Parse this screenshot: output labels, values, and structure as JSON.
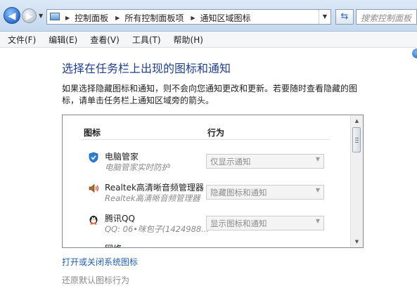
{
  "address_bar": {
    "crumbs": [
      "控制面板",
      "所有控制面板项",
      "通知区域图标"
    ],
    "search_placeholder": "搜索控制面板"
  },
  "menu": [
    "文件(F)",
    "编辑(E)",
    "查看(V)",
    "工具(T)",
    "帮助(H)"
  ],
  "main": {
    "title": "选择在任务栏上出现的图标和通知",
    "description": "如果选择隐藏图标和通知，则不会向您通知更改和更新。若要随时查看隐藏的图标，请单击任务栏上通知区域旁的箭头。",
    "table": {
      "col_icon": "图标",
      "col_behavior": "行为",
      "rows": [
        {
          "name": "电脑管家",
          "subtitle": "电脑管家实时防护",
          "behavior": "仅显示通知",
          "icon": "shield-icon"
        },
        {
          "name": "Realtek高清晰音频管理器",
          "subtitle": "Realtek高清晰音频管理器",
          "behavior": "隐藏图标和通知",
          "icon": "speaker-icon"
        },
        {
          "name": "腾讯QQ",
          "subtitle": "QQ: 06•咪包子(1424988...",
          "behavior": "显示图标和通知",
          "icon": "qq-penguin-icon"
        }
      ],
      "partial_row_name": "网络"
    },
    "link_system_icons": "打开或关闭系统图标",
    "link_restore_defaults": "还原默认图标行为"
  },
  "colors": {
    "title": "#1e3f8f",
    "link": "#1d5fb8"
  }
}
